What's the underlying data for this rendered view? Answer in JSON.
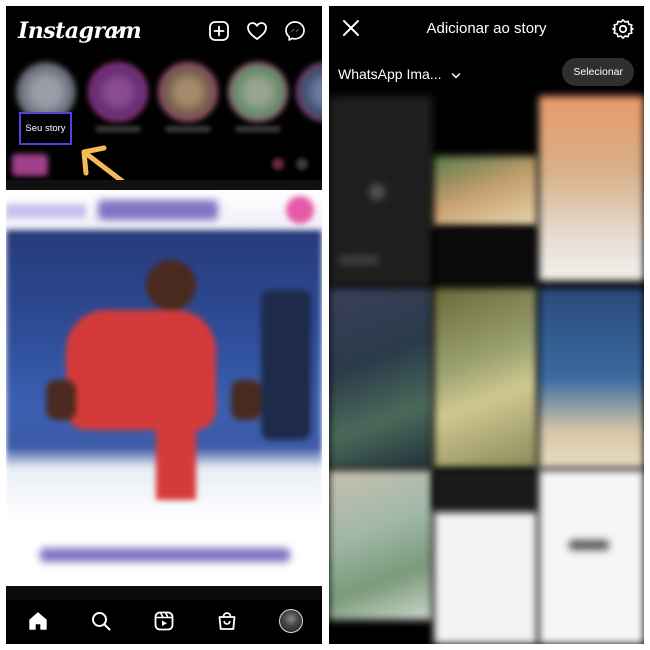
{
  "left_screen": {
    "app_logo": "Instagram",
    "story_label": "Seu story",
    "header_icons": [
      "plus-square-icon",
      "heart-icon",
      "messenger-icon"
    ],
    "bottom_nav": [
      "home-icon",
      "search-icon",
      "reels-icon",
      "shop-icon",
      "profile-avatar"
    ]
  },
  "right_screen": {
    "title": "Adicionar ao story",
    "album_name": "WhatsApp Ima...",
    "select_label": "Selecionar",
    "icons": [
      "close-icon",
      "settings-icon",
      "chevron-down-icon"
    ]
  },
  "colors": {
    "highlight_box": "#5a3fd8",
    "arrow": "#f5b955",
    "background": "#000000"
  }
}
